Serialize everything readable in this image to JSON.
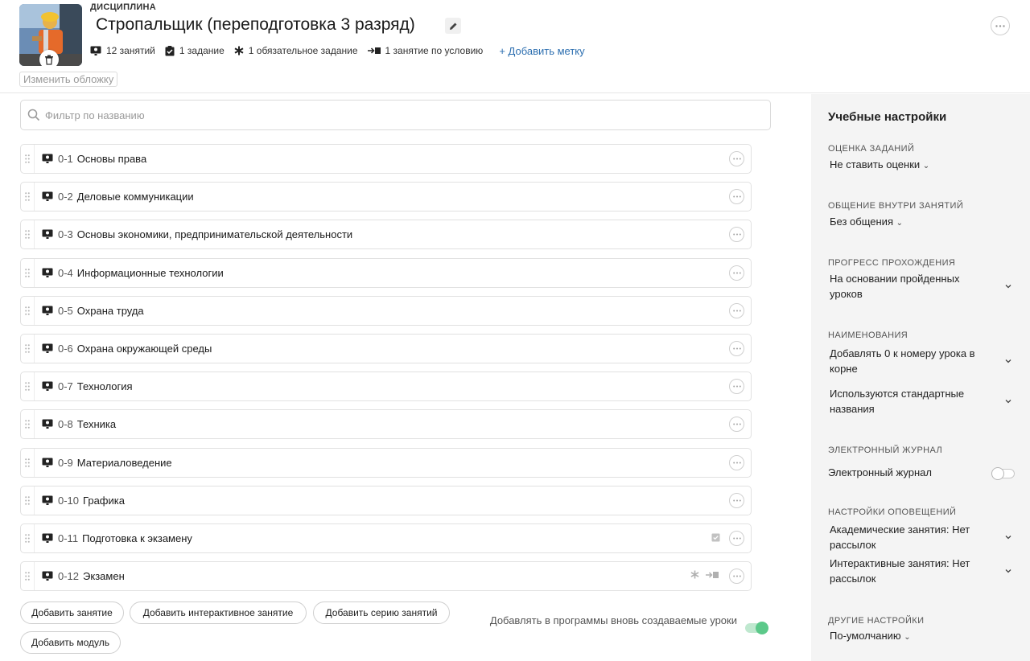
{
  "header": {
    "discipline_label": "ДИСЦИПЛИНА",
    "title": "Стропальщик (переподготовка 3 разряд)",
    "change_cover": "Изменить обложку",
    "stats": {
      "lessons": "12 занятий",
      "assignments": "1 задание",
      "required": "1 обязательное задание",
      "conditional": "1 занятие по условию"
    },
    "add_tag": "+ Добавить метку"
  },
  "filter": {
    "placeholder": "Фильтр по названию"
  },
  "lessons": [
    {
      "num": "0-1",
      "title": "Основы права"
    },
    {
      "num": "0-2",
      "title": "Деловые коммуникации"
    },
    {
      "num": "0-3",
      "title": "Основы экономики, предпринимательской деятельности"
    },
    {
      "num": "0-4",
      "title": "Информационные технологии"
    },
    {
      "num": "0-5",
      "title": "Охрана труда"
    },
    {
      "num": "0-6",
      "title": "Охрана окружающей среды"
    },
    {
      "num": "0-7",
      "title": "Технология"
    },
    {
      "num": "0-8",
      "title": "Техника"
    },
    {
      "num": "0-9",
      "title": "Материаловедение"
    },
    {
      "num": "0-10",
      "title": "Графика"
    },
    {
      "num": "0-11",
      "title": "Подготовка к экзамену"
    },
    {
      "num": "0-12",
      "title": "Экзамен"
    }
  ],
  "buttons": {
    "add_lesson": "Добавить занятие",
    "add_interactive": "Добавить интерактивное занятие",
    "add_series": "Добавить серию занятий",
    "add_module": "Добавить модуль"
  },
  "auto_add": {
    "label": "Добавлять в программы вновь создаваемые уроки",
    "enabled": true
  },
  "sidebar": {
    "title": "Учебные настройки",
    "grading": {
      "label": "ОЦЕНКА ЗАДАНИЙ",
      "value": "Не ставить оценки"
    },
    "communication": {
      "label": "ОБЩЕНИЕ ВНУТРИ ЗАНЯТИЙ",
      "value": "Без общения"
    },
    "progress": {
      "label": "ПРОГРЕСС ПРОХОЖДЕНИЯ",
      "value": "На основании пройденных уроков"
    },
    "naming": {
      "label": "НАИМЕНОВАНИЯ",
      "value1": "Добавлять 0 к номеру урока в корне",
      "value2": "Используются стандартные названия"
    },
    "journal": {
      "label": "ЭЛЕКТРОННЫЙ ЖУРНАЛ",
      "toggle_label": "Электронный журнал",
      "enabled": false
    },
    "notifications": {
      "label": "НАСТРОЙКИ ОПОВЕЩЕНИЙ",
      "academic": "Академические занятия: Нет рассылок",
      "interactive": "Интерактивные занятия: Нет рассылок"
    },
    "other": {
      "label": "ДРУГИЕ НАСТРОЙКИ",
      "value": "По-умолчанию"
    }
  },
  "colors": {
    "link": "#2d6fb0",
    "toggle_on": "#5cc98a",
    "sidebar_bg": "#f4f4f4"
  }
}
